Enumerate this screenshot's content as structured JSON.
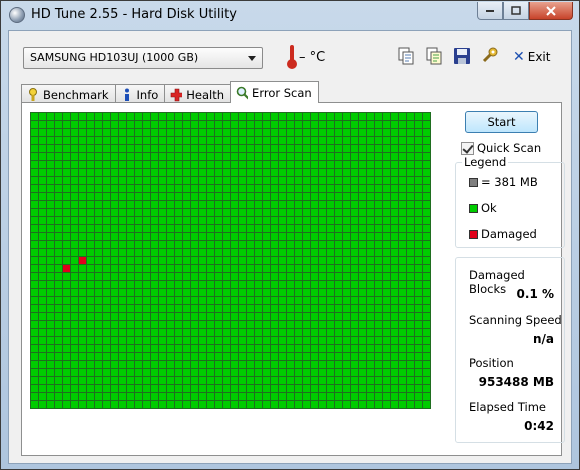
{
  "window": {
    "title": "HD Tune 2.55 - Hard Disk Utility",
    "caption_buttons": [
      "minimize",
      "maximize",
      "close"
    ]
  },
  "toolbar": {
    "drive": "SAMSUNG HD103UJ (1000 GB)",
    "temperature": "– °C",
    "exit_label": "Exit",
    "icons": [
      "copy-icon",
      "copy-info-icon",
      "save-icon",
      "options-icon"
    ]
  },
  "tabs": [
    {
      "label": "Benchmark",
      "icon": "benchmark-icon"
    },
    {
      "label": "Info",
      "icon": "info-icon"
    },
    {
      "label": "Health",
      "icon": "health-icon"
    },
    {
      "label": "Error Scan",
      "icon": "magnifier-icon",
      "active": true
    }
  ],
  "scan": {
    "start_label": "Start",
    "quick_scan_label": "Quick Scan",
    "quick_scan_checked": true,
    "grid": {
      "columns": 50,
      "rows": 37,
      "ok_color": "#00cc00",
      "damaged_color": "#e0001b",
      "damaged_blocks": [
        {
          "row": 18,
          "col": 6
        },
        {
          "row": 19,
          "col": 4
        }
      ]
    }
  },
  "legend": {
    "title": "Legend",
    "items": [
      {
        "label": "= 381 MB",
        "color": "#7f7f7f"
      },
      {
        "label": "Ok",
        "color": "#00cc00"
      },
      {
        "label": "Damaged",
        "color": "#e0001b"
      }
    ]
  },
  "stats": {
    "damaged_blocks_label": "Damaged Blocks",
    "damaged_blocks_value": "0.1 %",
    "scanning_speed_label": "Scanning Speed",
    "scanning_speed_value": "n/a",
    "position_label": "Position",
    "position_value": "953488 MB",
    "elapsed_label": "Elapsed Time",
    "elapsed_value": "0:42"
  }
}
